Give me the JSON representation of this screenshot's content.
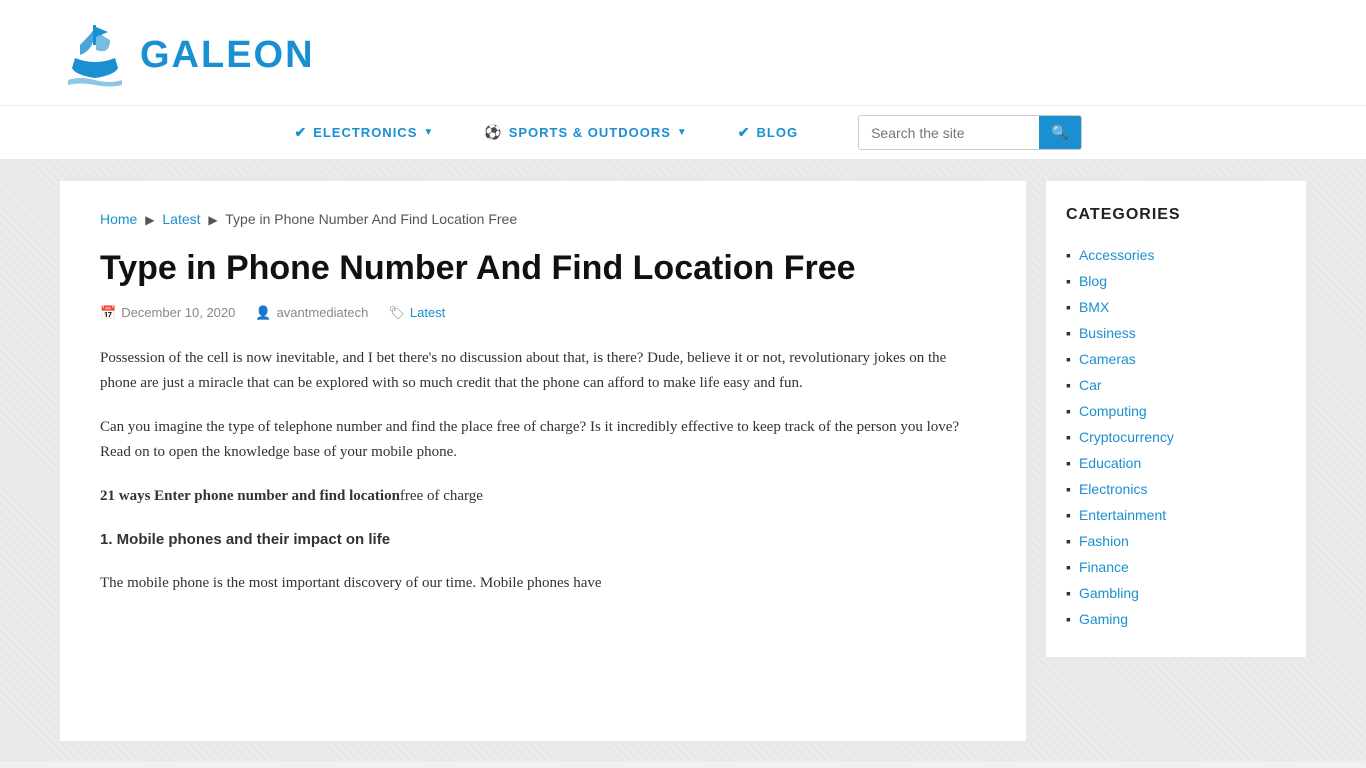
{
  "header": {
    "logo_text": "GALEON",
    "logo_icon_alt": "galeon ship logo"
  },
  "nav": {
    "items": [
      {
        "id": "electronics",
        "label": "ELECTRONICS",
        "icon": "✔",
        "has_dropdown": true
      },
      {
        "id": "sports-outdoors",
        "label": "SPORTS & OUTDOORS",
        "icon": "⚽",
        "has_dropdown": true
      },
      {
        "id": "blog",
        "label": "BLOG",
        "icon": "✔",
        "has_dropdown": false
      }
    ],
    "search": {
      "placeholder": "Search the site",
      "button_icon": "🔍"
    }
  },
  "breadcrumb": {
    "home": "Home",
    "latest": "Latest",
    "current": "Type in Phone Number And Find Location Free"
  },
  "article": {
    "title": "Type in Phone Number And Find Location Free",
    "date": "December 10, 2020",
    "author": "avantmediatech",
    "category": "Latest",
    "paragraphs": [
      "Possession of the cell is now inevitable, and I bet there's no discussion about that, is there? Dude, believe it or not, revolutionary jokes on the phone are just a miracle that can be explored with so much credit that the phone can afford to make life easy and fun.",
      "Can you imagine the type of telephone number and find the place free of charge? Is it incredibly effective to keep track of the person you love? Read on to open the knowledge base of your mobile phone."
    ],
    "bold_line_bold": "21 ways Enter phone number and find location",
    "bold_line_normal": "free of charge",
    "subheading": "1. Mobile phones and their impact on life",
    "subparagraph": "The mobile phone is the most important discovery of our time. Mobile phones have"
  },
  "sidebar": {
    "categories_title": "CATEGORIES",
    "categories": [
      "Accessories",
      "Blog",
      "BMX",
      "Business",
      "Cameras",
      "Car",
      "Computing",
      "Cryptocurrency",
      "Education",
      "Electronics",
      "Entertainment",
      "Fashion",
      "Finance",
      "Gambling",
      "Gaming"
    ]
  }
}
